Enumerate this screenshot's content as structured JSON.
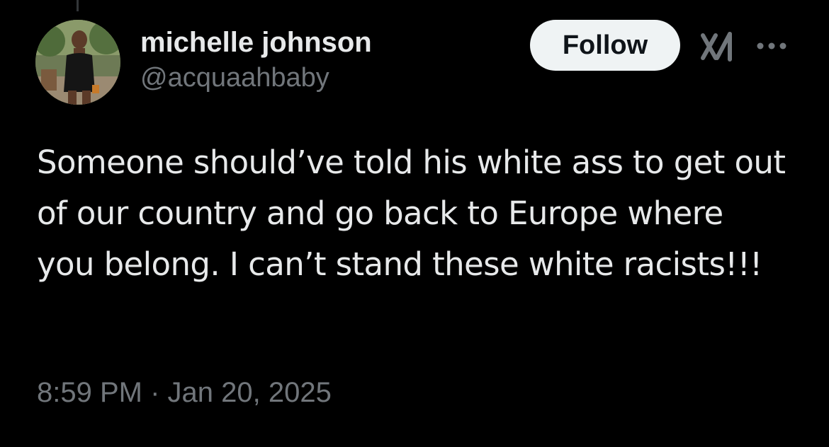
{
  "author": {
    "display_name": "michelle johnson",
    "handle": "@acquaahbaby"
  },
  "actions": {
    "follow_label": "Follow",
    "grok_icon": "grok-icon",
    "more_icon": "more-options-icon"
  },
  "tweet": {
    "text": "Someone should’ve told his white ass to get out of our country and go back to Europe where you belong. I can’t stand these white racists!!!",
    "timestamp": "8:59 PM · Jan 20, 2025"
  },
  "colors": {
    "background": "#000000",
    "primary_text": "#e7e9ea",
    "secondary_text": "#71767b",
    "follow_bg": "#eff3f4",
    "follow_text": "#0f1419"
  }
}
